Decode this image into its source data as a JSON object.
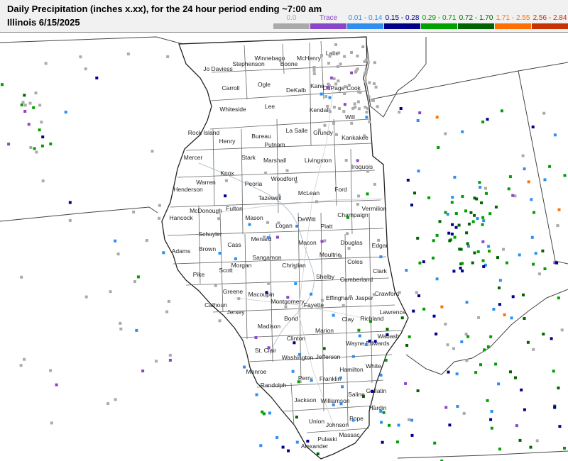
{
  "header": {
    "title": "Daily Precipitation (inches  x.xx),  for the 24 hour period ending ~7:00 am",
    "subtitle": "Illinois 6/15/2025"
  },
  "legend": [
    {
      "label": "0.0",
      "color": "#aaaaaa"
    },
    {
      "label": "Trace",
      "color": "#8a46c8"
    },
    {
      "label": "0.01 - 0.14",
      "color": "#2e8ff0"
    },
    {
      "label": "0.15 - 0.28",
      "color": "#00008b"
    },
    {
      "label": "0.29 - 0.71",
      "color": "#00a000"
    },
    {
      "label": "0.72 - 1.70",
      "color": "#006400"
    },
    {
      "label": "1.71 - 2.55",
      "color": "#ff7000"
    },
    {
      "label": "2.56 - 2.84",
      "color": "#c83200"
    }
  ],
  "counties": [
    {
      "name": "Jo Daviess"
    },
    {
      "name": "Stephenson"
    },
    {
      "name": "Winnebago"
    },
    {
      "name": "Boone"
    },
    {
      "name": "McHenry"
    },
    {
      "name": "Lake"
    },
    {
      "name": "Carroll"
    },
    {
      "name": "Ogle"
    },
    {
      "name": "DeKalb"
    },
    {
      "name": "Kane"
    },
    {
      "name": "DuPage"
    },
    {
      "name": "Cook"
    },
    {
      "name": "Whiteside"
    },
    {
      "name": "Lee"
    },
    {
      "name": "Kendall"
    },
    {
      "name": "Will"
    },
    {
      "name": "Rock Island"
    },
    {
      "name": "Henry"
    },
    {
      "name": "Bureau"
    },
    {
      "name": "La Salle"
    },
    {
      "name": "Grundy"
    },
    {
      "name": "Kankakee"
    },
    {
      "name": "Putnam"
    },
    {
      "name": "Mercer"
    },
    {
      "name": "Stark"
    },
    {
      "name": "Marshall"
    },
    {
      "name": "Livingston"
    },
    {
      "name": "Iroquois"
    },
    {
      "name": "Knox"
    },
    {
      "name": "Warren"
    },
    {
      "name": "Peoria"
    },
    {
      "name": "Woodford"
    },
    {
      "name": "Henderson"
    },
    {
      "name": "Tazewell"
    },
    {
      "name": "McLean"
    },
    {
      "name": "Ford"
    },
    {
      "name": "McDonough"
    },
    {
      "name": "Fulton"
    },
    {
      "name": "Vermilion"
    },
    {
      "name": "Champaign"
    },
    {
      "name": "Hancock"
    },
    {
      "name": "Mason"
    },
    {
      "name": "DeWitt"
    },
    {
      "name": "Schuyler"
    },
    {
      "name": "Logan"
    },
    {
      "name": "Piatt"
    },
    {
      "name": "Menard"
    },
    {
      "name": "Cass"
    },
    {
      "name": "Brown"
    },
    {
      "name": "Adams"
    },
    {
      "name": "Macon"
    },
    {
      "name": "Douglas"
    },
    {
      "name": "Edgar"
    },
    {
      "name": "Moultrie"
    },
    {
      "name": "Sangamon"
    },
    {
      "name": "Morgan"
    },
    {
      "name": "Christian"
    },
    {
      "name": "Coles"
    },
    {
      "name": "Scott"
    },
    {
      "name": "Pike"
    },
    {
      "name": "Clark"
    },
    {
      "name": "Shelby"
    },
    {
      "name": "Cumberland"
    },
    {
      "name": "Greene"
    },
    {
      "name": "Macoupin"
    },
    {
      "name": "Montgomery"
    },
    {
      "name": "Crawford"
    },
    {
      "name": "Jasper"
    },
    {
      "name": "Effingham"
    },
    {
      "name": "Calhoun"
    },
    {
      "name": "Jersey"
    },
    {
      "name": "Fayette"
    },
    {
      "name": "Lawrence"
    },
    {
      "name": "Richland"
    },
    {
      "name": "Clay"
    },
    {
      "name": "Bond"
    },
    {
      "name": "Madison"
    },
    {
      "name": "Wabash"
    },
    {
      "name": "Marion"
    },
    {
      "name": "Wayne"
    },
    {
      "name": "Edwards"
    },
    {
      "name": "Clinton"
    },
    {
      "name": "St. Clair"
    },
    {
      "name": "Washington"
    },
    {
      "name": "Jefferson"
    },
    {
      "name": "White"
    },
    {
      "name": "Hamilton"
    },
    {
      "name": "Monroe"
    },
    {
      "name": "Perry"
    },
    {
      "name": "Franklin"
    },
    {
      "name": "Randolph"
    },
    {
      "name": "Saline"
    },
    {
      "name": "Gallatin"
    },
    {
      "name": "Jackson"
    },
    {
      "name": "Williamson"
    },
    {
      "name": "Hardin"
    },
    {
      "name": "Union"
    },
    {
      "name": "Johnson"
    },
    {
      "name": "Pope"
    },
    {
      "name": "Massac"
    },
    {
      "name": "Pulaski"
    },
    {
      "name": "Alexander"
    }
  ]
}
